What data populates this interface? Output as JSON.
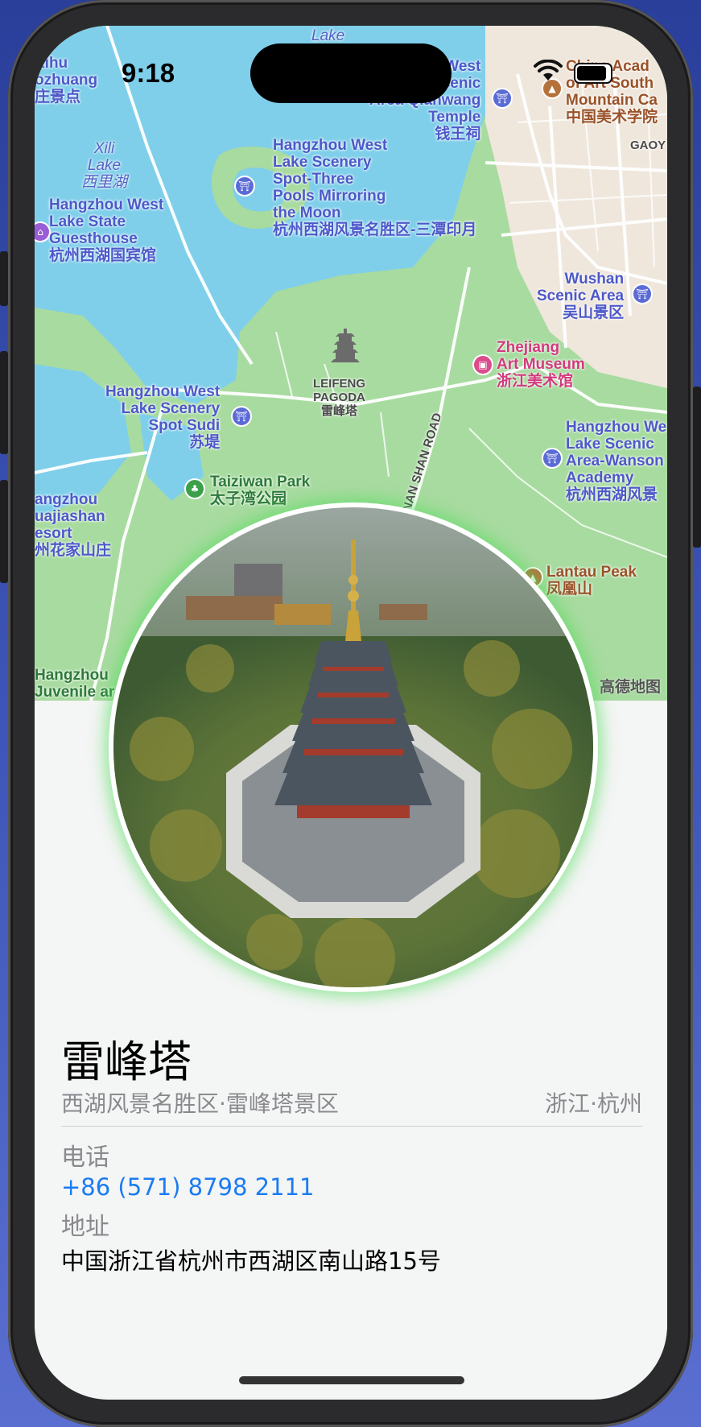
{
  "status_bar": {
    "time": "9:18"
  },
  "map": {
    "attribution": "高德地图",
    "labels": [
      {
        "id": "xihu-top",
        "text": "Xihu\nozhuang\n庄景点",
        "kind": "normal"
      },
      {
        "id": "lake-top",
        "text": "Lake",
        "kind": "italic"
      },
      {
        "id": "west-lake-qianwang",
        "text": "West\nScenic\nArea Qianwang\nTemple\n钱王祠",
        "kind": "normal"
      },
      {
        "id": "china-academy",
        "text": "China Acad\nof Art South\nMountain Ca\n中国美术学院",
        "kind": "brown"
      },
      {
        "id": "gaoyin",
        "text": "GAOY",
        "kind": "dark"
      },
      {
        "id": "xili-lake",
        "text": "Xili\nLake\n西里湖",
        "kind": "italic"
      },
      {
        "id": "three-pools",
        "text": "Hangzhou West\nLake Scenery\nSpot-Three\nPools Mirroring\nthe Moon\n杭州西湖风景名胜区-三潭印月",
        "kind": "normal"
      },
      {
        "id": "state-guesthouse",
        "text": "Hangzhou West\nLake State\nGuesthouse\n杭州西湖国宾馆",
        "kind": "normal"
      },
      {
        "id": "wushan",
        "text": "Wushan\nScenic Area\n吴山景区",
        "kind": "normal"
      },
      {
        "id": "leifeng-pagoda",
        "text": "LEIFENG\nPAGODA\n雷峰塔",
        "kind": "dark"
      },
      {
        "id": "art-museum",
        "text": "Zhejiang\nArt Museum\n浙江美术馆",
        "kind": "pink"
      },
      {
        "id": "sudi",
        "text": "Hangzhou West\nLake Scenery\nSpot Sudi\n苏堤",
        "kind": "normal"
      },
      {
        "id": "wanson",
        "text": "Hangzhou We\nLake Scenic\nArea-Wanson\nAcademy\n杭州西湖风景",
        "kind": "normal"
      },
      {
        "id": "taiziwan",
        "text": "Taiziwan Park\n太子湾公园",
        "kind": "green"
      },
      {
        "id": "huajiashan",
        "text": "angzhou\nuajiashan\nesort\n州花家山庄",
        "kind": "normal"
      },
      {
        "id": "road",
        "text": "NAN SHAN ROAD",
        "kind": "dark"
      },
      {
        "id": "lantau",
        "text": "Lantau Peak\n凤凰山",
        "kind": "brown"
      },
      {
        "id": "juvenile",
        "text": "Hangzhou\nJuvenile ar",
        "kind": "green"
      }
    ]
  },
  "place": {
    "name": "雷峰塔",
    "area": "西湖风景名胜区·雷峰塔景区",
    "region": "浙江·杭州",
    "phone_label": "电话",
    "phone": "+86 (571) 8798 2111",
    "address_label": "地址",
    "address": "中国浙江省杭州市西湖区南山路15号"
  },
  "colors": {
    "accent_link": "#1a7cf2",
    "photo_glow": "#50dc5a",
    "water": "#7fcfea",
    "land": "#a8dba0"
  }
}
